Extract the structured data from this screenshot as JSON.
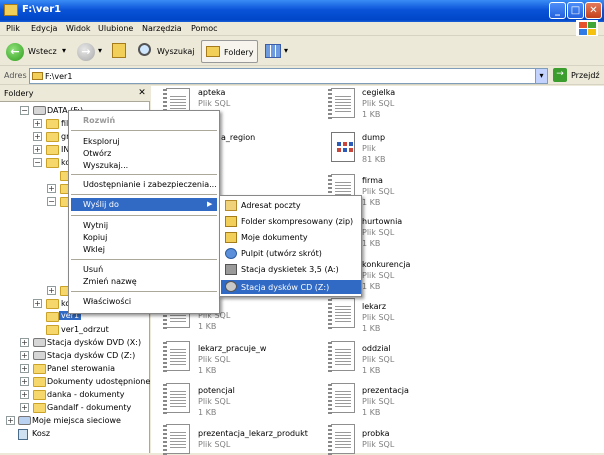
{
  "window": {
    "title": "F:\\ver1"
  },
  "menu": [
    "Plik",
    "Edycja",
    "Widok",
    "Ulubione",
    "Narzędzia",
    "Pomoc"
  ],
  "toolbar": {
    "back": "Wstecz",
    "search": "Wyszukaj",
    "folders": "Foldery"
  },
  "address": {
    "label": "Adres",
    "value": "F:\\ver1",
    "go": "Przejdź"
  },
  "folders_pane": {
    "title": "Foldery",
    "tree": {
      "drive": "DATA (F:)",
      "n1": "fil",
      "n2": "gr",
      "n3": "IN",
      "n4": "ko",
      "n8": "ko",
      "ver1": "ver1",
      "ver1_odrzut": "ver1_odrzut",
      "dvd": "Stacja dysków DVD (X:)",
      "cd": "Stacja dysków CD (Z:)",
      "panel": "Panel sterowania",
      "shared": "Dokumenty udostępnione",
      "danka": "danka - dokumenty",
      "gandalf": "Gandalf - dokumenty",
      "network": "Moje miejsca sieciowe",
      "trash": "Kosz"
    }
  },
  "files": [
    {
      "name": "apteka",
      "type": "Plik SQL",
      "size": "1 KB"
    },
    {
      "name": "cegielka",
      "type": "Plik SQL",
      "size": "1 KB"
    },
    {
      "name": "a_region",
      "type": "",
      "size": ""
    },
    {
      "name": "dump",
      "type": "Plik",
      "size": "81 KB"
    },
    {
      "name": "firma",
      "type": "Plik SQL",
      "size": "1 KB"
    },
    {
      "name": "hurtownia",
      "type": "Plik SQL",
      "size": "1 KB"
    },
    {
      "name": "konkurencja",
      "type": "Plik SQL",
      "size": "1 KB"
    },
    {
      "name": "lekarz",
      "type": "Plik SQL",
      "size": "1 KB"
    },
    {
      "name": "",
      "type": "Plik SQL",
      "size": "1 KB"
    },
    {
      "name": "lekarz_pracuje_w",
      "type": "Plik SQL",
      "size": "1 KB"
    },
    {
      "name": "oddzial",
      "type": "Plik SQL",
      "size": "1 KB"
    },
    {
      "name": "potencjal",
      "type": "Plik SQL",
      "size": "1 KB"
    },
    {
      "name": "prezentacja",
      "type": "Plik SQL",
      "size": "1 KB"
    },
    {
      "name": "prezentacja_lekarz_produkt",
      "type": "Plik SQL",
      "size": ""
    },
    {
      "name": "probka",
      "type": "Plik SQL",
      "size": ""
    }
  ],
  "context_menu": {
    "rozwin": "Rozwiń",
    "eksploruj": "Eksploruj",
    "otworz": "Otwórz",
    "wyszukaj": "Wyszukaj...",
    "udostepnianie": "Udostępnianie i zabezpieczenia...",
    "wyslij": "Wyślij do",
    "wytnij": "Wytnij",
    "kopiuj": "Kopiuj",
    "wklej": "Wklej",
    "usun": "Usuń",
    "zmien": "Zmień nazwę",
    "wlasciwosci": "Właściwości"
  },
  "send_to": {
    "adresat": "Adresat poczty",
    "zip": "Folder skompresowany (zip)",
    "dokumenty": "Moje dokumenty",
    "pulpit": "Pulpit (utwórz skrót)",
    "dyskietka": "Stacja dyskietek 3,5 (A:)",
    "cd": "Stacja dysków CD (Z:)"
  },
  "colors": {
    "highlight": "#316ac5",
    "titlebar": "#0a53d8",
    "sql_type": "#808080"
  }
}
